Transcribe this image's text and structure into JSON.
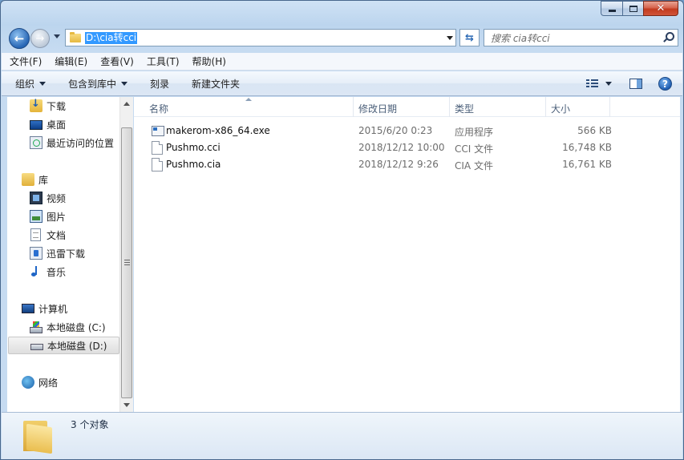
{
  "window": {
    "address_path": "D:\\cia转cci",
    "search_placeholder": "搜索 cia转cci"
  },
  "menu": [
    "文件(F)",
    "编辑(E)",
    "查看(V)",
    "工具(T)",
    "帮助(H)"
  ],
  "toolbar": {
    "organize": "组织",
    "include_in_library": "包含到库中",
    "burn": "刻录",
    "new_folder": "新建文件夹"
  },
  "nav": {
    "favorites": [
      "下载",
      "桌面",
      "最近访问的位置"
    ],
    "library": "库",
    "library_items": [
      "视频",
      "图片",
      "文档",
      "迅雷下载",
      "音乐"
    ],
    "computer": "计算机",
    "drives": [
      "本地磁盘 (C:)",
      "本地磁盘 (D:)"
    ],
    "network": "网络"
  },
  "columns": [
    "名称",
    "修改日期",
    "类型",
    "大小"
  ],
  "files": [
    {
      "name": "makerom-x86_64.exe",
      "date": "2015/6/20 0:23",
      "type": "应用程序",
      "size": "566 KB",
      "icon": "exe-icon"
    },
    {
      "name": "Pushmo.cci",
      "date": "2018/12/12 10:00",
      "type": "CCI 文件",
      "size": "16,748 KB",
      "icon": "file-icon"
    },
    {
      "name": "Pushmo.cia",
      "date": "2018/12/12 9:26",
      "type": "CIA 文件",
      "size": "16,761 KB",
      "icon": "file-icon"
    }
  ],
  "status": {
    "count_text": "3 个对象"
  },
  "colors": {
    "selection": "#3399ff",
    "frame": "#bcd5ee",
    "close_button": "#c23b1f"
  }
}
